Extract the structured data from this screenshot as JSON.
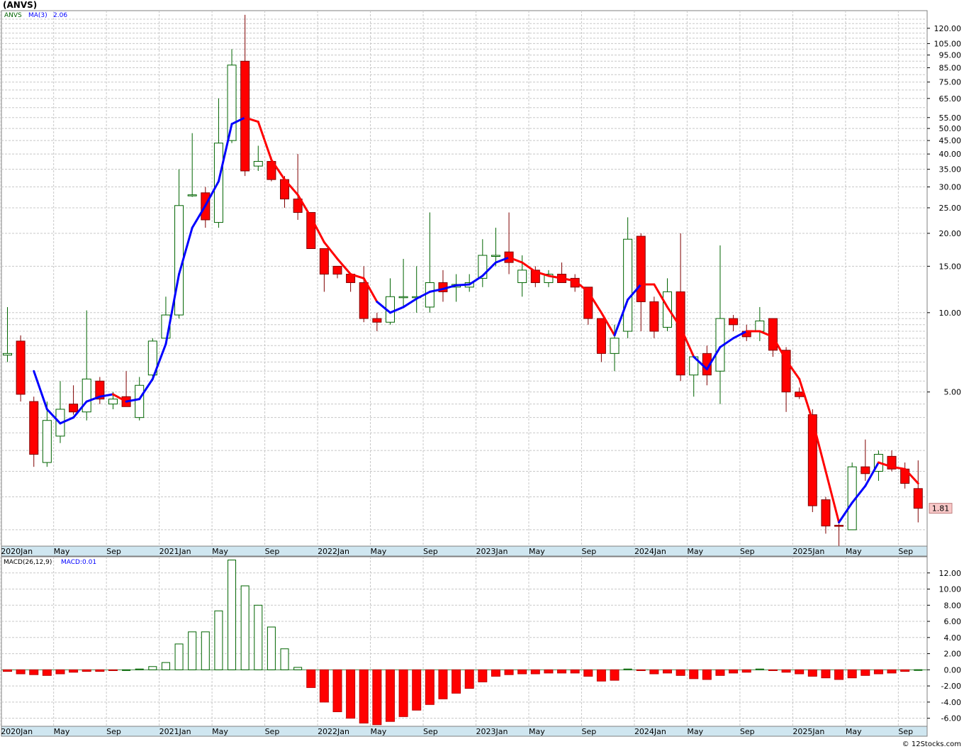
{
  "colors": {
    "up": "#006400",
    "down": "#ff0000",
    "ma_up": "#0000ff",
    "ma_down": "#ff0000",
    "grid": "#c8c8c8",
    "axis_strip": "#cfe6f0",
    "last_price_bg": "#f8c8c8"
  },
  "chart_data": [
    {
      "type": "candlestick",
      "title": "(ANVS)",
      "scale": "log",
      "ylim": [
        1.3,
        140
      ],
      "yticks": [
        "120.00",
        "105.00",
        "95.00",
        "85.00",
        "75.00",
        "65.00",
        "55.00",
        "50.00",
        "45.00",
        "40.00",
        "35.00",
        "30.00",
        "25.00",
        "20.00",
        "15.00",
        "10.00",
        "5.00"
      ],
      "legend": {
        "symbol": "ANVS",
        "ma_label": "MA(3)",
        "ma_value": "2.06"
      },
      "last_price_label": "1.81",
      "x_labels": [
        "2020Jan",
        "May",
        "Sep",
        "2021Jan",
        "May",
        "Sep",
        "2022Jan",
        "May",
        "Sep",
        "2023Jan",
        "May",
        "Sep",
        "2024Jan",
        "May",
        "Sep",
        "2025Jan",
        "May",
        "Sep"
      ],
      "x_start": "2020-01",
      "bars": [
        {
          "o": 6.9,
          "h": 10.5,
          "l": 6.5,
          "c": 7.0
        },
        {
          "o": 7.8,
          "h": 8.2,
          "l": 4.6,
          "c": 4.9
        },
        {
          "o": 4.6,
          "h": 4.8,
          "l": 2.6,
          "c": 2.9
        },
        {
          "o": 2.7,
          "h": 4.6,
          "l": 2.6,
          "c": 3.9
        },
        {
          "o": 3.4,
          "h": 5.5,
          "l": 3.2,
          "c": 4.3
        },
        {
          "o": 4.5,
          "h": 5.3,
          "l": 4.1,
          "c": 4.2
        },
        {
          "o": 4.2,
          "h": 10.2,
          "l": 3.9,
          "c": 5.6
        },
        {
          "o": 5.5,
          "h": 5.7,
          "l": 4.5,
          "c": 4.7
        },
        {
          "o": 4.5,
          "h": 5.0,
          "l": 4.3,
          "c": 4.7
        },
        {
          "o": 4.8,
          "h": 6.0,
          "l": 4.4,
          "c": 4.4
        },
        {
          "o": 4.0,
          "h": 5.7,
          "l": 3.9,
          "c": 5.3
        },
        {
          "o": 5.8,
          "h": 8.0,
          "l": 5.5,
          "c": 7.8
        },
        {
          "o": 8.0,
          "h": 11.5,
          "l": 8.0,
          "c": 9.8
        },
        {
          "o": 9.8,
          "h": 35.0,
          "l": 9.5,
          "c": 25.5
        },
        {
          "o": 28.0,
          "h": 48.0,
          "l": 27.5,
          "c": 28.0
        },
        {
          "o": 28.5,
          "h": 30.0,
          "l": 21.0,
          "c": 22.5
        },
        {
          "o": 22.0,
          "h": 65.0,
          "l": 21.0,
          "c": 44.0
        },
        {
          "o": 45.0,
          "h": 100.0,
          "l": 44.0,
          "c": 87.0
        },
        {
          "o": 90.0,
          "h": 135.0,
          "l": 33.0,
          "c": 34.5
        },
        {
          "o": 36.0,
          "h": 43.0,
          "l": 34.5,
          "c": 37.5
        },
        {
          "o": 37.5,
          "h": 39.0,
          "l": 31.5,
          "c": 32.0
        },
        {
          "o": 32.0,
          "h": 33.0,
          "l": 25.0,
          "c": 27.0
        },
        {
          "o": 27.0,
          "h": 40.0,
          "l": 22.5,
          "c": 24.0
        },
        {
          "o": 24.0,
          "h": 24.0,
          "l": 17.5,
          "c": 17.5
        },
        {
          "o": 17.5,
          "h": 17.5,
          "l": 12.0,
          "c": 14.0
        },
        {
          "o": 15.0,
          "h": 15.0,
          "l": 13.5,
          "c": 14.0
        },
        {
          "o": 14.0,
          "h": 14.0,
          "l": 12.0,
          "c": 13.0
        },
        {
          "o": 13.0,
          "h": 15.0,
          "l": 9.2,
          "c": 9.5
        },
        {
          "o": 9.5,
          "h": 10.0,
          "l": 8.5,
          "c": 9.2
        },
        {
          "o": 9.2,
          "h": 13.5,
          "l": 9.0,
          "c": 11.5
        },
        {
          "o": 11.5,
          "h": 16.0,
          "l": 10.5,
          "c": 11.5
        },
        {
          "o": 11.5,
          "h": 15.0,
          "l": 10.0,
          "c": 11.5
        },
        {
          "o": 10.5,
          "h": 24.0,
          "l": 10.0,
          "c": 13.0
        },
        {
          "o": 13.0,
          "h": 14.5,
          "l": 11.0,
          "c": 12.0
        },
        {
          "o": 12.5,
          "h": 14.0,
          "l": 11.0,
          "c": 12.8
        },
        {
          "o": 12.5,
          "h": 14.0,
          "l": 12.0,
          "c": 13.0
        },
        {
          "o": 13.5,
          "h": 19.0,
          "l": 12.5,
          "c": 16.5
        },
        {
          "o": 16.5,
          "h": 21.0,
          "l": 15.0,
          "c": 16.5
        },
        {
          "o": 17.0,
          "h": 24.0,
          "l": 14.0,
          "c": 15.5
        },
        {
          "o": 13.0,
          "h": 16.5,
          "l": 11.5,
          "c": 14.5
        },
        {
          "o": 14.5,
          "h": 15.0,
          "l": 12.5,
          "c": 13.0
        },
        {
          "o": 13.0,
          "h": 14.5,
          "l": 12.5,
          "c": 14.0
        },
        {
          "o": 14.0,
          "h": 15.5,
          "l": 13.0,
          "c": 13.0
        },
        {
          "o": 13.5,
          "h": 14.0,
          "l": 12.0,
          "c": 12.5
        },
        {
          "o": 12.5,
          "h": 12.5,
          "l": 9.0,
          "c": 9.5
        },
        {
          "o": 9.5,
          "h": 9.5,
          "l": 6.5,
          "c": 7.0
        },
        {
          "o": 7.0,
          "h": 9.0,
          "l": 6.0,
          "c": 8.0
        },
        {
          "o": 8.5,
          "h": 23.0,
          "l": 8.0,
          "c": 19.0
        },
        {
          "o": 19.5,
          "h": 20.0,
          "l": 8.5,
          "c": 11.0
        },
        {
          "o": 11.0,
          "h": 11.5,
          "l": 8.0,
          "c": 8.5
        },
        {
          "o": 8.8,
          "h": 13.5,
          "l": 8.5,
          "c": 12.0
        },
        {
          "o": 12.0,
          "h": 20.0,
          "l": 5.5,
          "c": 5.8
        },
        {
          "o": 5.8,
          "h": 6.0,
          "l": 4.8,
          "c": 6.8
        },
        {
          "o": 7.0,
          "h": 7.5,
          "l": 5.3,
          "c": 5.8
        },
        {
          "o": 6.0,
          "h": 18.0,
          "l": 4.5,
          "c": 9.5
        },
        {
          "o": 9.5,
          "h": 9.8,
          "l": 8.5,
          "c": 9.0
        },
        {
          "o": 8.5,
          "h": 9.0,
          "l": 7.8,
          "c": 8.1
        },
        {
          "o": 8.5,
          "h": 10.5,
          "l": 7.8,
          "c": 9.3
        },
        {
          "o": 9.5,
          "h": 9.5,
          "l": 6.8,
          "c": 7.2
        },
        {
          "o": 7.2,
          "h": 7.4,
          "l": 4.2,
          "c": 5.0
        },
        {
          "o": 5.0,
          "h": 5.2,
          "l": 4.7,
          "c": 4.8
        },
        {
          "o": 4.1,
          "h": 4.3,
          "l": 1.75,
          "c": 1.85
        },
        {
          "o": 1.95,
          "h": 2.0,
          "l": 1.45,
          "c": 1.55
        },
        {
          "o": 1.56,
          "h": 1.58,
          "l": 1.3,
          "c": 1.55
        },
        {
          "o": 1.5,
          "h": 2.7,
          "l": 1.5,
          "c": 2.6
        },
        {
          "o": 2.6,
          "h": 3.3,
          "l": 2.3,
          "c": 2.45
        },
        {
          "o": 2.5,
          "h": 3.0,
          "l": 2.3,
          "c": 2.9
        },
        {
          "o": 2.85,
          "h": 3.0,
          "l": 2.5,
          "c": 2.55
        },
        {
          "o": 2.55,
          "h": 2.7,
          "l": 2.15,
          "c": 2.25
        },
        {
          "o": 2.15,
          "h": 2.75,
          "l": 1.6,
          "c": 1.81
        }
      ],
      "ma": [
        null,
        null,
        6.0,
        4.3,
        3.8,
        4.0,
        4.6,
        4.8,
        4.9,
        4.6,
        4.7,
        5.6,
        7.6,
        14.0,
        21.0,
        25.5,
        31.5,
        52.0,
        55.0,
        53.0,
        38.0,
        32.0,
        28.0,
        23.0,
        18.5,
        16.0,
        14.0,
        13.5,
        11.0,
        10.0,
        10.5,
        11.3,
        12.0,
        12.3,
        12.7,
        12.8,
        13.8,
        15.5,
        16.2,
        15.5,
        14.3,
        13.8,
        13.5,
        13.2,
        12.0,
        10.0,
        8.2,
        11.2,
        12.8,
        12.8,
        10.5,
        8.8,
        6.8,
        6.1,
        7.4,
        8.0,
        8.5,
        8.5,
        8.1,
        6.6,
        5.6,
        3.9,
        2.5,
        1.6,
        1.9,
        2.2,
        2.7,
        2.6,
        2.55,
        2.25
      ],
      "ma_color_change": [
        null,
        null,
        "down",
        "up",
        "up",
        "up",
        "up",
        "up",
        "up",
        "down",
        "up",
        "up",
        "up",
        "up",
        "up",
        "up",
        "up",
        "up",
        "up",
        "down",
        "down",
        "down",
        "down",
        "down",
        "down",
        "down",
        "down",
        "down",
        "down",
        "up",
        "up",
        "up",
        "up",
        "up",
        "up",
        "up",
        "up",
        "up",
        "up",
        "down",
        "down",
        "down",
        "down",
        "down",
        "down",
        "down",
        "down",
        "up",
        "up",
        "down",
        "down",
        "down",
        "down",
        "up",
        "up",
        "up",
        "up",
        "down",
        "down",
        "down",
        "down",
        "down",
        "down",
        "down",
        "up",
        "up",
        "up",
        "down",
        "down",
        "down"
      ]
    },
    {
      "type": "bar",
      "title": "MACD(26,12,9)",
      "legend_value": "MACD:0.01",
      "ylim": [
        -7,
        14
      ],
      "yticks": [
        "12.00",
        "10.00",
        "8.00",
        "6.00",
        "4.00",
        "2.00",
        "0.00",
        "-2.00",
        "-4.00",
        "-6.00"
      ],
      "values": [
        -0.2,
        -0.5,
        -0.6,
        -0.7,
        -0.5,
        -0.3,
        -0.2,
        -0.2,
        -0.1,
        0.0,
        0.1,
        0.4,
        0.9,
        3.2,
        4.7,
        4.7,
        7.3,
        13.6,
        10.4,
        8.0,
        5.3,
        2.6,
        0.3,
        -2.2,
        -4.0,
        -5.2,
        -6.0,
        -6.6,
        -6.8,
        -6.4,
        -5.8,
        -5.0,
        -4.3,
        -3.6,
        -2.9,
        -2.3,
        -1.5,
        -0.8,
        -0.6,
        -0.5,
        -0.5,
        -0.4,
        -0.4,
        -0.4,
        -0.8,
        -1.4,
        -1.3,
        0.1,
        -0.1,
        -0.5,
        -0.4,
        -0.7,
        -1.1,
        -1.2,
        -0.7,
        -0.4,
        -0.3,
        0.1,
        -0.1,
        -0.3,
        -0.5,
        -0.8,
        -1.0,
        -1.2,
        -1.0,
        -0.7,
        -0.5,
        -0.4,
        -0.2,
        0.01
      ]
    }
  ],
  "credit": "© 12Stocks.com"
}
